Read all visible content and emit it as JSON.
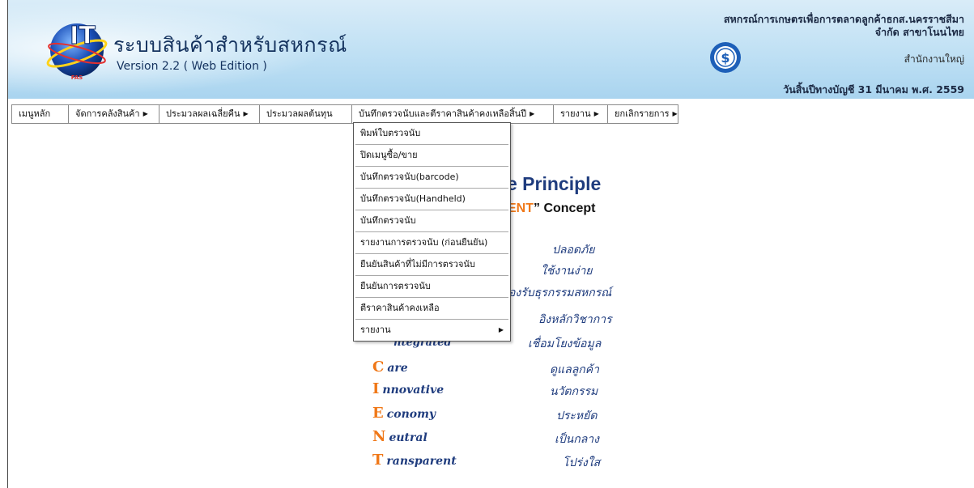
{
  "header": {
    "app_title": "ระบบสินค้าสำหรับสหกรณ์",
    "app_version": "Version 2.2 ( Web Edition )",
    "org_line1": "สหกรณ์การเกษตรเพื่อการตลาดลูกค้าธกส.นครราชสีมา",
    "org_line2": "จำกัด สาขาโนนไทย",
    "branch": "สำนักงานใหญ่",
    "fiscal_year": "วันสิ้นปีทางบัญชี 31 มีนาคม พ.ศ. 2559",
    "logo_text": "IT",
    "logo_small": "FAS"
  },
  "menu": [
    {
      "label": "เมนูหลัก",
      "arrow": false
    },
    {
      "label": "จัดการคลังสินค้า",
      "arrow": true
    },
    {
      "label": "ประมวลผลเฉลี่ยคืน",
      "arrow": true
    },
    {
      "label": "ประมวลผลต้นทุน",
      "arrow": false
    },
    {
      "label": "บันทึกตรวจนับและตีราคาสินค้าคงเหลือสิ้นปี",
      "arrow": true
    },
    {
      "label": "รายงาน",
      "arrow": true
    },
    {
      "label": "ยกเลิกรายการ",
      "arrow": true
    }
  ],
  "dropdown": [
    {
      "label": "พิมพ์ใบตรวจนับ"
    },
    {
      "label": "ปิดเมนูซื้อ/ขาย"
    },
    {
      "label": "บันทึกตรวจนับ(barcode)"
    },
    {
      "label": "บันทึกตรวจนับ(Handheld)"
    },
    {
      "label": "บันทึกตรวจนับ"
    },
    {
      "label": "รายงานการตรวจนับ (ก่อนยืนยัน)"
    },
    {
      "label": "ยืนยันสินค้าที่ไม่มีการตรวจนับ"
    },
    {
      "label": "ยืนยันการตรวจนับ"
    },
    {
      "label": "ตีราคาสินค้าคงเหลือ"
    },
    {
      "label": "รายงาน",
      "submenu": true
    }
  ],
  "principle": {
    "title_partial": "e Principle",
    "concept_partial_orange": "ENT",
    "concept_partial_rest": "” Concept"
  },
  "visible_thai": [
    "ปลอดภัย",
    "ใช้งานง่าย",
    "องรับธุรกรรมสหกรณ์",
    "อิงหลักวิชาการ",
    "เชื่อมโยงข้อมูล"
  ],
  "client_words": [
    {
      "cap": "C",
      "rest": "are",
      "thai": "ดูแลลูกค้า"
    },
    {
      "cap": "I",
      "rest": "nnovative",
      "thai": "นวัตกรรม"
    },
    {
      "cap": "E",
      "rest": "conomy",
      "thai": "ประหยัด"
    },
    {
      "cap": "N",
      "rest": "eutral",
      "thai": "เป็นกลาง"
    },
    {
      "cap": "T",
      "rest": "ransparent",
      "thai": "โปร่งใส"
    }
  ],
  "integrated_partial": "ntegrated",
  "colors": {
    "accent_orange": "#f07818",
    "title_blue": "#1f3c7e",
    "header_blue": "#bfe0f4"
  }
}
